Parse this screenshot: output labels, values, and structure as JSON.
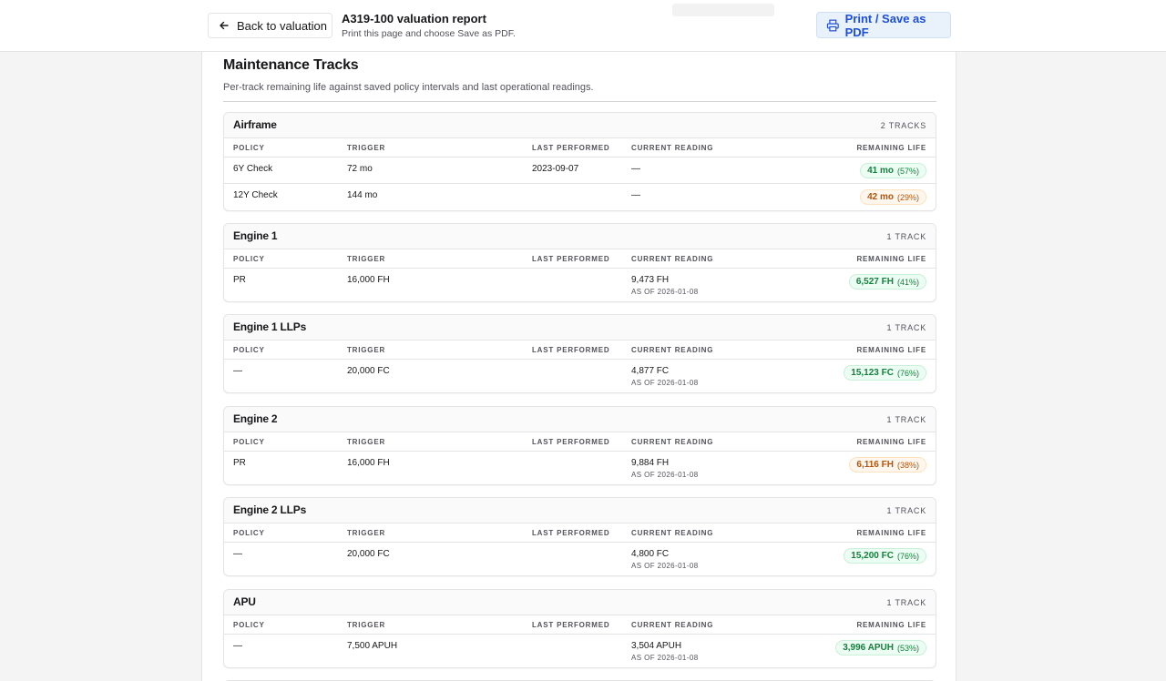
{
  "toolbar": {
    "back_label": "Back to valuation",
    "title": "A319-100 valuation report",
    "subtitle": "Print this page and choose Save as PDF.",
    "print_label": "Print / Save as PDF"
  },
  "section": {
    "title": "Maintenance Tracks",
    "subtitle": "Per-track remaining life against saved policy intervals and last operational readings."
  },
  "columns": {
    "policy": "POLICY",
    "trigger": "TRIGGER",
    "last_performed": "LAST PERFORMED",
    "current_reading": "CURRENT READING",
    "remaining_life": "REMAINING LIFE"
  },
  "groups": [
    {
      "name": "Airframe",
      "count": "2 TRACKS",
      "rows": [
        {
          "policy": "6Y Check",
          "trigger": "72 mo",
          "last": "2023-09-07",
          "current": "—",
          "asof": "",
          "remaining": "41 mo",
          "pct": "(57%)",
          "status": "green"
        },
        {
          "policy": "12Y Check",
          "trigger": "144 mo",
          "last": "",
          "current": "—",
          "asof": "",
          "remaining": "42 mo",
          "pct": "(29%)",
          "status": "amber"
        }
      ]
    },
    {
      "name": "Engine 1",
      "count": "1 TRACK",
      "rows": [
        {
          "policy": "PR",
          "trigger": "16,000 FH",
          "last": "",
          "current": "9,473 FH",
          "asof": "AS OF 2026-01-08",
          "remaining": "6,527 FH",
          "pct": "(41%)",
          "status": "green"
        }
      ]
    },
    {
      "name": "Engine 1 LLPs",
      "count": "1 TRACK",
      "rows": [
        {
          "policy": "—",
          "trigger": "20,000 FC",
          "last": "",
          "current": "4,877 FC",
          "asof": "AS OF 2026-01-08",
          "remaining": "15,123 FC",
          "pct": "(76%)",
          "status": "green"
        }
      ]
    },
    {
      "name": "Engine 2",
      "count": "1 TRACK",
      "rows": [
        {
          "policy": "PR",
          "trigger": "16,000 FH",
          "last": "",
          "current": "9,884 FH",
          "asof": "AS OF 2026-01-08",
          "remaining": "6,116 FH",
          "pct": "(38%)",
          "status": "amber"
        }
      ]
    },
    {
      "name": "Engine 2 LLPs",
      "count": "1 TRACK",
      "rows": [
        {
          "policy": "—",
          "trigger": "20,000 FC",
          "last": "",
          "current": "4,800 FC",
          "asof": "AS OF 2026-01-08",
          "remaining": "15,200 FC",
          "pct": "(76%)",
          "status": "green"
        }
      ]
    },
    {
      "name": "APU",
      "count": "1 TRACK",
      "rows": [
        {
          "policy": "—",
          "trigger": "7,500 APUH",
          "last": "",
          "current": "3,504 APUH",
          "asof": "AS OF 2026-01-08",
          "remaining": "3,996 APUH",
          "pct": "(53%)",
          "status": "green"
        }
      ]
    }
  ],
  "colors": {
    "green": "#15803d",
    "amber": "#b45309",
    "accent": "#1d4ed8"
  }
}
